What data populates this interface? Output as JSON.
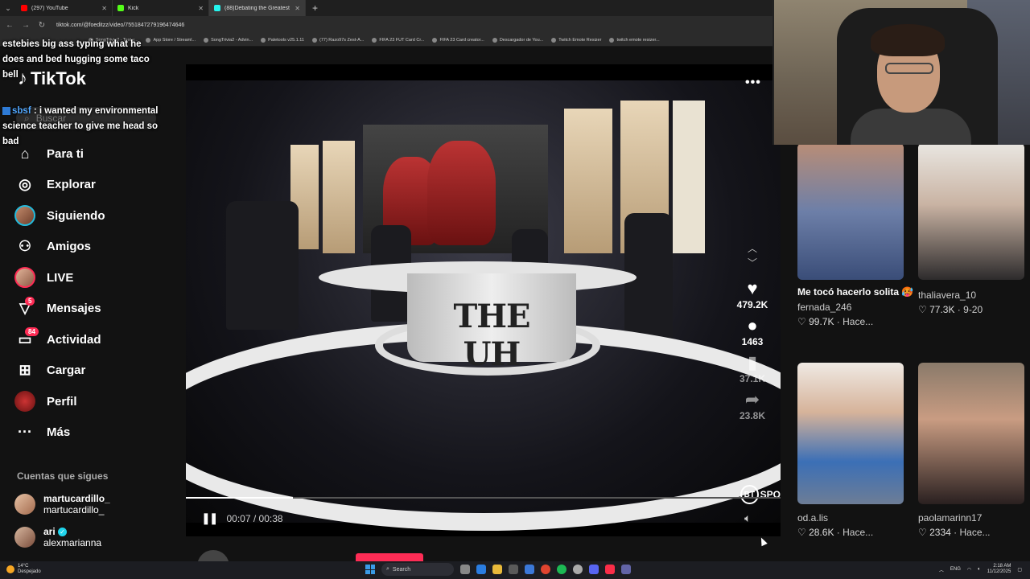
{
  "browser": {
    "tabs": [
      {
        "title": "(297) YouTube",
        "color": "#ff0000",
        "active": false
      },
      {
        "title": "Kick",
        "color": "#53fc18",
        "active": false
      },
      {
        "title": "(88)Debating the Greatest",
        "color": "#25f4ee",
        "active": true
      }
    ],
    "url": "tiktok.com/@foeditzz/video/7551847279196474646",
    "bookmarks": [
      "SongTrivia2 - Test y...",
      "App Store / Streaml...",
      "SongTrivia2 - Advin...",
      "Paletools v25.1.11",
      "(77) Razo97s Zest-A...",
      "FIFA 23 FUT Card Cr...",
      "FIFA 23 Card creator...",
      "Descargador de You...",
      "Twitch Emote Resizer",
      "twitch emote resizer..."
    ]
  },
  "chat": {
    "line1": "estebies big ass typing what he does and bed hugging some taco bell",
    "user": "sbsf",
    "line2": ": i wanted my environmental science teacher to give me head so bad"
  },
  "tiktok": {
    "logo": "TikTok",
    "search_placeholder": "Buscar",
    "nav": [
      {
        "label": "Para ti",
        "icon": "home-icon",
        "badge": ""
      },
      {
        "label": "Explorar",
        "icon": "compass-icon",
        "badge": ""
      },
      {
        "label": "Siguiendo",
        "icon": "following-avatar-icon",
        "badge": ""
      },
      {
        "label": "Amigos",
        "icon": "friends-icon",
        "badge": ""
      },
      {
        "label": "LIVE",
        "icon": "live-avatar-icon",
        "badge": ""
      },
      {
        "label": "Mensajes",
        "icon": "messages-icon",
        "badge": "5"
      },
      {
        "label": "Actividad",
        "icon": "activity-icon",
        "badge": "84"
      },
      {
        "label": "Cargar",
        "icon": "upload-icon",
        "badge": ""
      },
      {
        "label": "Perfil",
        "icon": "profile-avatar-icon",
        "badge": ""
      },
      {
        "label": "Más",
        "icon": "more-icon",
        "badge": ""
      }
    ],
    "following_header": "Cuentas que sigues",
    "following": [
      {
        "name": "martucardillo_",
        "handle": "martucardillo_",
        "verified": false
      },
      {
        "name": "ari",
        "handle": "alexmarianna",
        "verified": true
      }
    ]
  },
  "video": {
    "desk_text": "THE UH",
    "likes": "479.2K",
    "comments": "1463",
    "saves": "37.1K",
    "shares": "23.8K",
    "time_current": "00:07",
    "time_total": "00:38",
    "progress": 0.18,
    "watermark": "SPO",
    "author": "foeditzz"
  },
  "recommended": [
    {
      "caption": "Me tocó hacerlo solita 🥵",
      "user": "fernada_246",
      "likes": "99.7K",
      "time": "Hace..."
    },
    {
      "caption": "",
      "user": "thaliavera_10",
      "likes": "77.3K",
      "time": "9-20"
    },
    {
      "caption": "",
      "user": "od.a.lis",
      "likes": "28.6K",
      "time": "Hace..."
    },
    {
      "caption": "",
      "user": "paolamarinn17",
      "likes": "2334",
      "time": "Hace..."
    }
  ],
  "taskbar": {
    "weather_temp": "14°C",
    "weather_text": "Despejado",
    "search": "Search",
    "lang": "ENG",
    "time": "2:18 AM",
    "date": "11/12/2025"
  }
}
